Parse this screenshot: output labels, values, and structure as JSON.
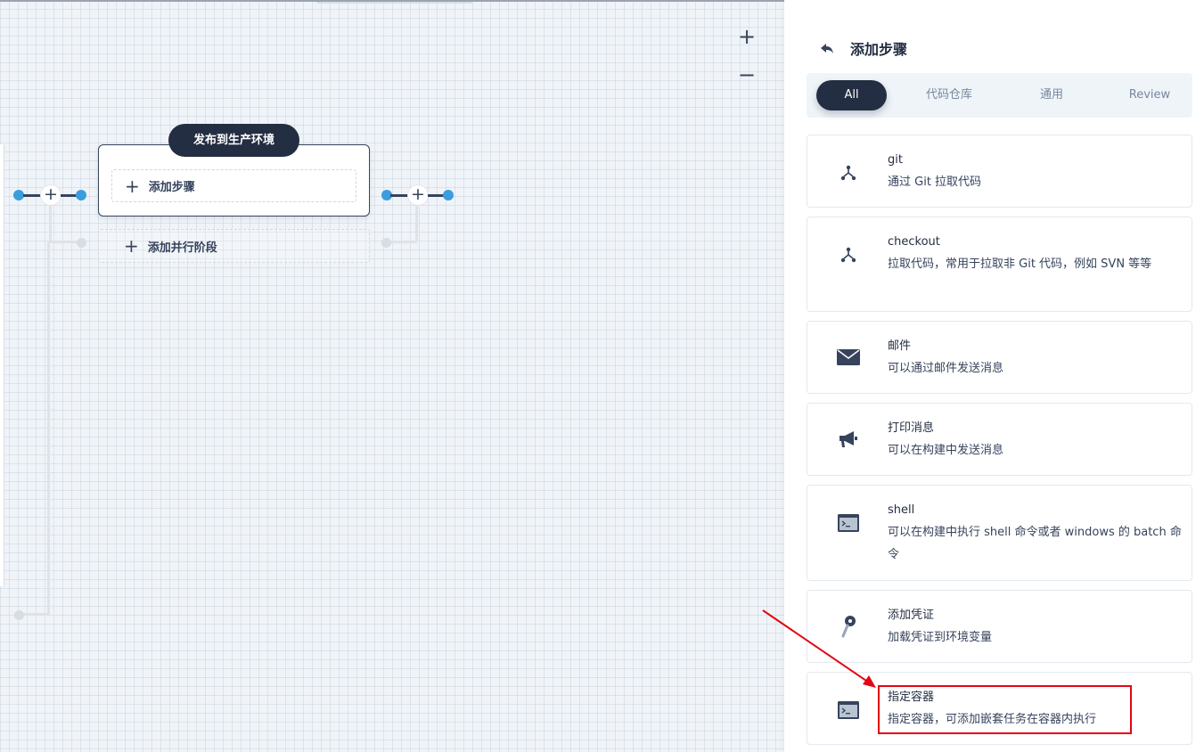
{
  "canvas": {
    "zoom_in_label": "+",
    "zoom_out_label": "−",
    "stage": {
      "title": "发布到生产环境",
      "add_step_label": "添加步骤",
      "add_parallel_label": "添加并行阶段"
    }
  },
  "panel": {
    "title": "添加步骤",
    "tabs": [
      {
        "label": "All",
        "active": true
      },
      {
        "label": "代码仓库",
        "active": false
      },
      {
        "label": "通用",
        "active": false
      },
      {
        "label": "Review",
        "active": false
      }
    ],
    "steps": [
      {
        "name": "git",
        "desc": "通过 Git 拉取代码",
        "icon": "git-branch-icon"
      },
      {
        "name": "checkout",
        "desc": "拉取代码，常用于拉取非 Git 代码，例如 SVN 等等",
        "icon": "git-branch-icon"
      },
      {
        "name": "邮件",
        "desc": "可以通过邮件发送消息",
        "icon": "mail-icon"
      },
      {
        "name": "打印消息",
        "desc": "可以在构建中发送消息",
        "icon": "megaphone-icon"
      },
      {
        "name": "shell",
        "desc": "可以在构建中执行 shell 命令或者 windows 的 batch 命令",
        "icon": "terminal-icon"
      },
      {
        "name": "添加凭证",
        "desc": "加载凭证到环境变量",
        "icon": "key-icon"
      },
      {
        "name": "指定容器",
        "desc": "指定容器，可添加嵌套任务在容器内执行",
        "icon": "terminal-icon"
      }
    ]
  },
  "annotation": {
    "highlight_color": "#e30613"
  },
  "colors": {
    "primary_dark": "#242e42",
    "connector_blue": "#3b9ddd",
    "panel_bg": "#ffffff"
  }
}
